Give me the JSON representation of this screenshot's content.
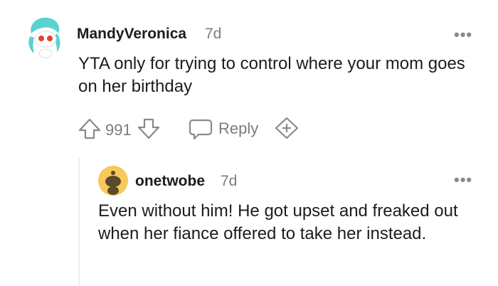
{
  "comment": {
    "username": "MandyVeronica",
    "time": "7d",
    "text": "YTA only for trying to control where your mom goes on her birthday",
    "votes": "991",
    "reply_label": "Reply"
  },
  "reply": {
    "username": "onetwobe",
    "time": "7d",
    "text": "Even without him! He got upset and freaked out when her fiance offered to take her instead."
  },
  "colors": {
    "text": "#1c1c1c",
    "muted": "#7c7c7c",
    "avatar_yellow": "#f7c85a",
    "avatar_teal": "#64d2d2"
  },
  "icons": [
    "upvote-icon",
    "downvote-icon",
    "comment-bubble-icon",
    "award-icon",
    "more-options-icon"
  ]
}
